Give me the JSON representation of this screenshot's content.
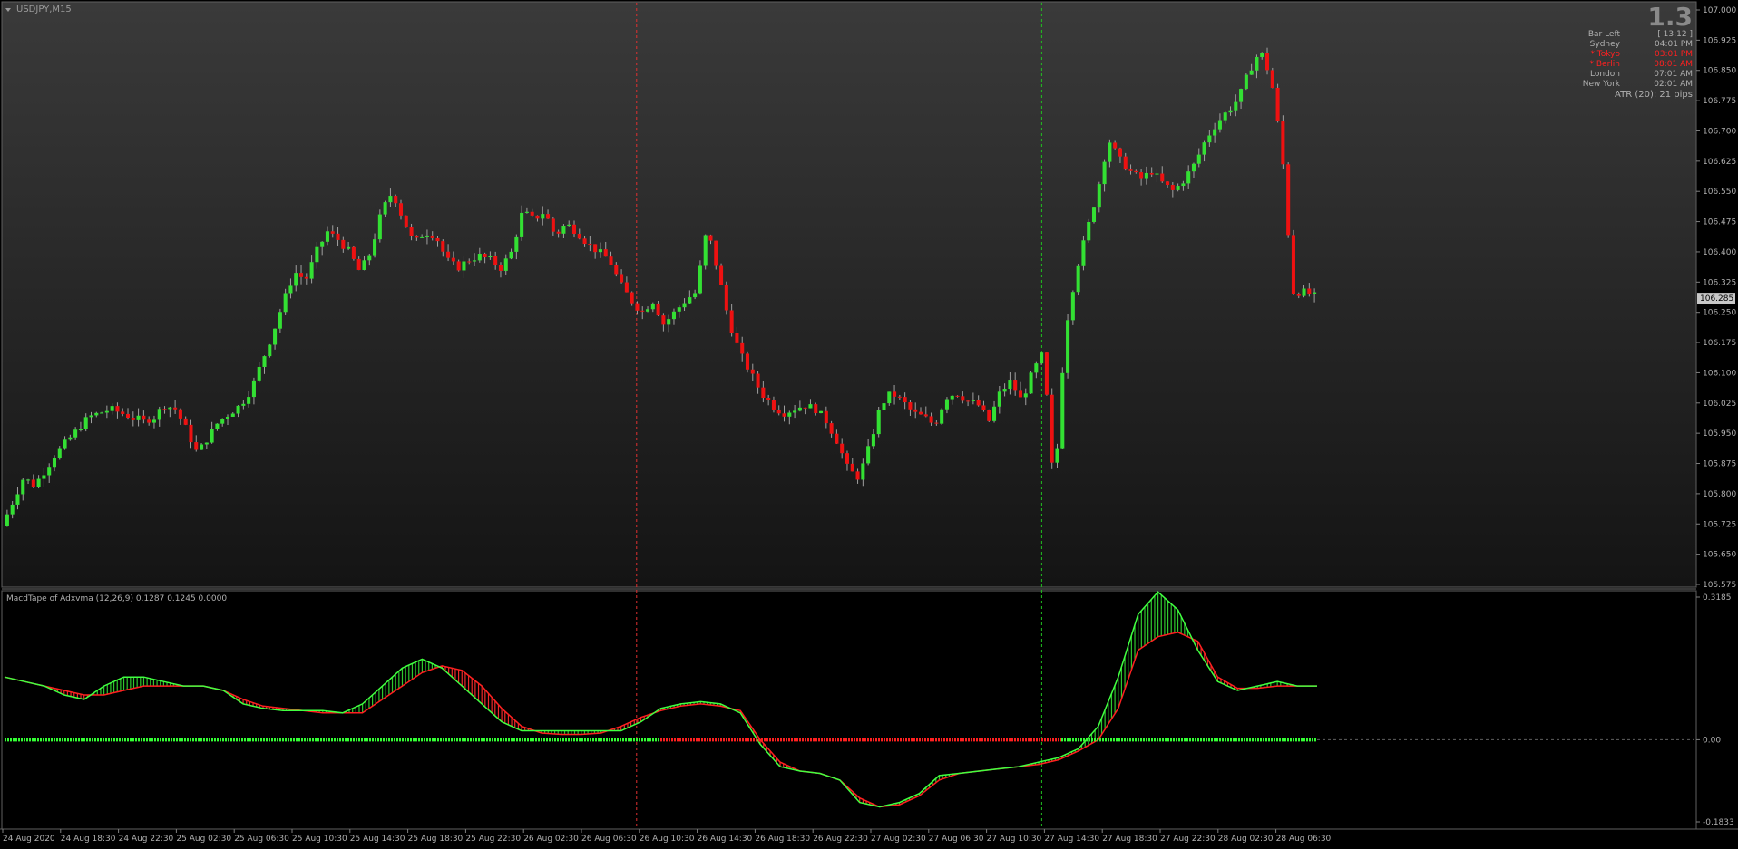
{
  "window": {
    "symbol_label": "USDJPY,M15",
    "indicator_label": "MacdTape of Adxvma (12,26,9) 0.1287 0.1245 0.0000"
  },
  "info_panel": {
    "big_value": "1.3",
    "rows": [
      {
        "label": "Bar Left",
        "value": "[ 13:12 ]",
        "color": "#b0b0b0"
      },
      {
        "label": "Sydney",
        "value": "04:01 PM",
        "color": "#b0b0b0"
      },
      {
        "label": "* Tokyo",
        "value": "03:01 PM",
        "color": "#ff2020"
      },
      {
        "label": "* Berlin",
        "value": "08:01 AM",
        "color": "#ff2020"
      },
      {
        "label": "London",
        "value": "07:01 AM",
        "color": "#b0b0b0"
      },
      {
        "label": "New York",
        "value": "02:01 AM",
        "color": "#b0b0b0"
      }
    ],
    "atr": "ATR (20): 21 pips"
  },
  "chart_data": [
    {
      "type": "candlestick",
      "title": "USDJPY,M15",
      "y_ticks": [
        "107.000",
        "106.925",
        "106.850",
        "106.775",
        "106.700",
        "106.625",
        "106.550",
        "106.475",
        "106.400",
        "106.325",
        "106.250",
        "106.175",
        "106.100",
        "106.025",
        "105.950",
        "105.875",
        "105.800",
        "105.725",
        "105.650",
        "105.575"
      ],
      "ylim": [
        105.575,
        107.0
      ],
      "current_price": "106.285",
      "x_ticks": [
        "24 Aug 2020",
        "24 Aug 18:30",
        "24 Aug 22:30",
        "25 Aug 02:30",
        "25 Aug 06:30",
        "25 Aug 10:30",
        "25 Aug 14:30",
        "25 Aug 18:30",
        "25 Aug 22:30",
        "26 Aug 02:30",
        "26 Aug 06:30",
        "26 Aug 10:30",
        "26 Aug 14:30",
        "26 Aug 18:30",
        "26 Aug 22:30",
        "27 Aug 02:30",
        "27 Aug 06:30",
        "27 Aug 10:30",
        "27 Aug 14:30",
        "27 Aug 18:30",
        "27 Aug 22:30",
        "28 Aug 02:30",
        "28 Aug 06:30"
      ],
      "close_path": [
        105.72,
        105.78,
        105.84,
        105.82,
        105.86,
        105.9,
        105.93,
        105.96,
        105.99,
        106.0,
        106.01,
        106.0,
        105.99,
        105.98,
        105.99,
        106.02,
        106.01,
        105.96,
        105.9,
        105.94,
        105.98,
        106.0,
        106.02,
        106.06,
        106.13,
        106.2,
        106.28,
        106.35,
        106.33,
        106.4,
        106.45,
        106.43,
        106.4,
        106.35,
        106.4,
        106.5,
        106.55,
        106.48,
        106.42,
        106.45,
        106.44,
        106.38,
        106.36,
        106.38,
        106.39,
        106.38,
        106.36,
        106.4,
        106.5,
        106.48,
        106.5,
        106.44,
        106.47,
        106.45,
        106.42,
        106.4,
        106.38,
        106.32,
        106.28,
        106.25,
        106.28,
        106.22,
        106.25,
        106.28,
        106.3,
        106.46,
        106.35,
        106.23,
        106.15,
        106.1,
        106.05,
        106.02,
        106.0,
        106.01,
        106.02,
        106.01,
        105.98,
        105.93,
        105.86,
        105.84,
        105.92,
        106.02,
        106.05,
        106.03,
        106.0,
        105.99,
        105.97,
        106.04,
        106.05,
        106.03,
        106.02,
        105.98,
        106.05,
        106.08,
        106.03,
        106.1,
        106.15,
        105.8,
        106.2,
        106.35,
        106.45,
        106.55,
        106.68,
        106.63,
        106.6,
        106.58,
        106.6,
        106.57,
        106.55,
        106.58,
        106.62,
        106.68,
        106.72,
        106.75,
        106.78,
        106.85,
        106.9,
        106.83,
        106.65,
        106.3,
        106.3,
        106.29
      ],
      "vertical_lines": [
        {
          "x_label": "26 Aug 10:30",
          "color": "#e03030"
        },
        {
          "x_label": "27 Aug 14:30",
          "color": "#20c020"
        }
      ]
    },
    {
      "type": "area",
      "title": "MacdTape of Adxvma (12,26,9)",
      "values_shown": [
        0.1287,
        0.1245,
        0.0
      ],
      "y_ticks": [
        "0.3185",
        "0.00",
        "-0.1833"
      ],
      "ylim": [
        -0.1833,
        0.3185
      ],
      "macd": [
        0.14,
        0.13,
        0.12,
        0.1,
        0.09,
        0.12,
        0.14,
        0.14,
        0.13,
        0.12,
        0.12,
        0.11,
        0.08,
        0.07,
        0.065,
        0.065,
        0.065,
        0.06,
        0.08,
        0.12,
        0.16,
        0.18,
        0.16,
        0.12,
        0.08,
        0.04,
        0.02,
        0.02,
        0.02,
        0.02,
        0.02,
        0.02,
        0.04,
        0.07,
        0.08,
        0.085,
        0.08,
        0.06,
        -0.01,
        -0.06,
        -0.07,
        -0.075,
        -0.09,
        -0.14,
        -0.15,
        -0.14,
        -0.12,
        -0.08,
        -0.075,
        -0.07,
        -0.065,
        -0.06,
        -0.05,
        -0.04,
        -0.02,
        0.03,
        0.14,
        0.28,
        0.33,
        0.29,
        0.2,
        0.13,
        0.11,
        0.12,
        0.13,
        0.12,
        0.12
      ],
      "signal": [
        0.14,
        0.13,
        0.12,
        0.11,
        0.1,
        0.1,
        0.11,
        0.12,
        0.12,
        0.12,
        0.12,
        0.11,
        0.09,
        0.075,
        0.07,
        0.065,
        0.06,
        0.06,
        0.06,
        0.09,
        0.12,
        0.15,
        0.165,
        0.155,
        0.12,
        0.07,
        0.03,
        0.015,
        0.012,
        0.012,
        0.015,
        0.03,
        0.05,
        0.065,
        0.075,
        0.08,
        0.075,
        0.065,
        0.0,
        -0.05,
        -0.07,
        -0.075,
        -0.09,
        -0.13,
        -0.15,
        -0.145,
        -0.125,
        -0.09,
        -0.075,
        -0.07,
        -0.065,
        -0.06,
        -0.055,
        -0.045,
        -0.025,
        0.0,
        0.07,
        0.2,
        0.23,
        0.24,
        0.22,
        0.14,
        0.115,
        0.115,
        0.12,
        0.12,
        0.12
      ]
    }
  ]
}
